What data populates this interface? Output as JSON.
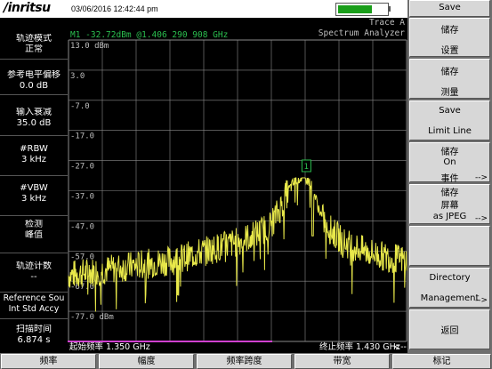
{
  "header": {
    "logo": "/inritsu",
    "datetime": "03/06/2016 12:42:44 pm",
    "battery_level": 0.7
  },
  "left_panel": [
    {
      "line1": "轨迹模式",
      "line2": "正常"
    },
    {
      "line1": "参考电平偏移",
      "line2": "0.0 dB"
    },
    {
      "line1": "输入衰减",
      "line2": "35.0 dB"
    },
    {
      "line1": "#RBW",
      "line2": "3 kHz"
    },
    {
      "line1": "#VBW",
      "line2": "3 kHz"
    },
    {
      "line1": "检测",
      "line2": "峰值"
    },
    {
      "line1": "轨迹计数",
      "line2": "--"
    },
    {
      "line1": "Reference Sou",
      "line2": "Int Std Accy"
    },
    {
      "line1": "扫描时间",
      "line2": "6.874 s"
    }
  ],
  "plot": {
    "trace_label": "Trace A",
    "mode": "Spectrum Analyzer",
    "marker_readout": "M1 -32.72dBm @1.406 290 908 GHz",
    "marker_label": "1",
    "ref_level": "13.0 dBm",
    "ticks": [
      "3.0",
      "-7.0",
      "-17.0",
      "-27.0",
      "-37.0",
      "-47.0",
      "-57.0",
      "-67.0",
      "-77.0 dBm"
    ],
    "start_freq": "起始频率  1.350 GHz",
    "stop_freq": "终止频率  1.430 GHz",
    "stop_arrow": "<--"
  },
  "chart_data": {
    "type": "line",
    "xlabel": "",
    "ylabel": "",
    "xlim": [
      1.35,
      1.43
    ],
    "ylim": [
      -87,
      13
    ],
    "grid": true,
    "series": [
      {
        "x": [
          1.35,
          1.355,
          1.36,
          1.365,
          1.37,
          1.375,
          1.38,
          1.385,
          1.39,
          1.395,
          1.398,
          1.4,
          1.402,
          1.404,
          1.405,
          1.406,
          1.407,
          1.408,
          1.409,
          1.41,
          1.412,
          1.415,
          1.42,
          1.425,
          1.43
        ],
        "y": [
          -65,
          -64,
          -63,
          -62,
          -61,
          -60,
          -58,
          -56,
          -54,
          -51,
          -48,
          -43,
          -37,
          -33,
          -32.7,
          -32.7,
          -34,
          -37,
          -42,
          -46,
          -50,
          -54,
          -57,
          -59,
          -60
        ]
      }
    ],
    "marker": {
      "x": 1.40629,
      "y": -32.72
    }
  },
  "softkeys": [
    {
      "line1": "Save",
      "line2": "",
      "line3": "",
      "arrow": ""
    },
    {
      "line1": "储存",
      "line2": "设置",
      "line3": "",
      "arrow": ""
    },
    {
      "line1": "储存",
      "line2": "测量",
      "line3": "",
      "arrow": ""
    },
    {
      "line1": "Save",
      "line2": "Limit Line",
      "line3": "",
      "arrow": ""
    },
    {
      "line1": "储存",
      "line2": "On",
      "line3": "事件",
      "arrow": "-->"
    },
    {
      "line1": "储存",
      "line2": "屏幕",
      "line3": "as JPEG",
      "arrow": "-->"
    },
    {
      "line1": "",
      "line2": "",
      "line3": "",
      "arrow": ""
    },
    {
      "line1": "Directory",
      "line2": "Management",
      "line3": "",
      "arrow": "-->"
    },
    {
      "line1": "返回",
      "line2": "",
      "line3": "",
      "arrow": ""
    }
  ],
  "bottom_tabs": [
    "频率",
    "幅度",
    "频率跨度",
    "带宽",
    "标记"
  ],
  "colors": {
    "trace": "#e8e84a",
    "grid": "#8a8a8a",
    "text_green": "#2bbf4f",
    "text_gray": "#bfbfbf",
    "start_line": "#d040d0"
  }
}
